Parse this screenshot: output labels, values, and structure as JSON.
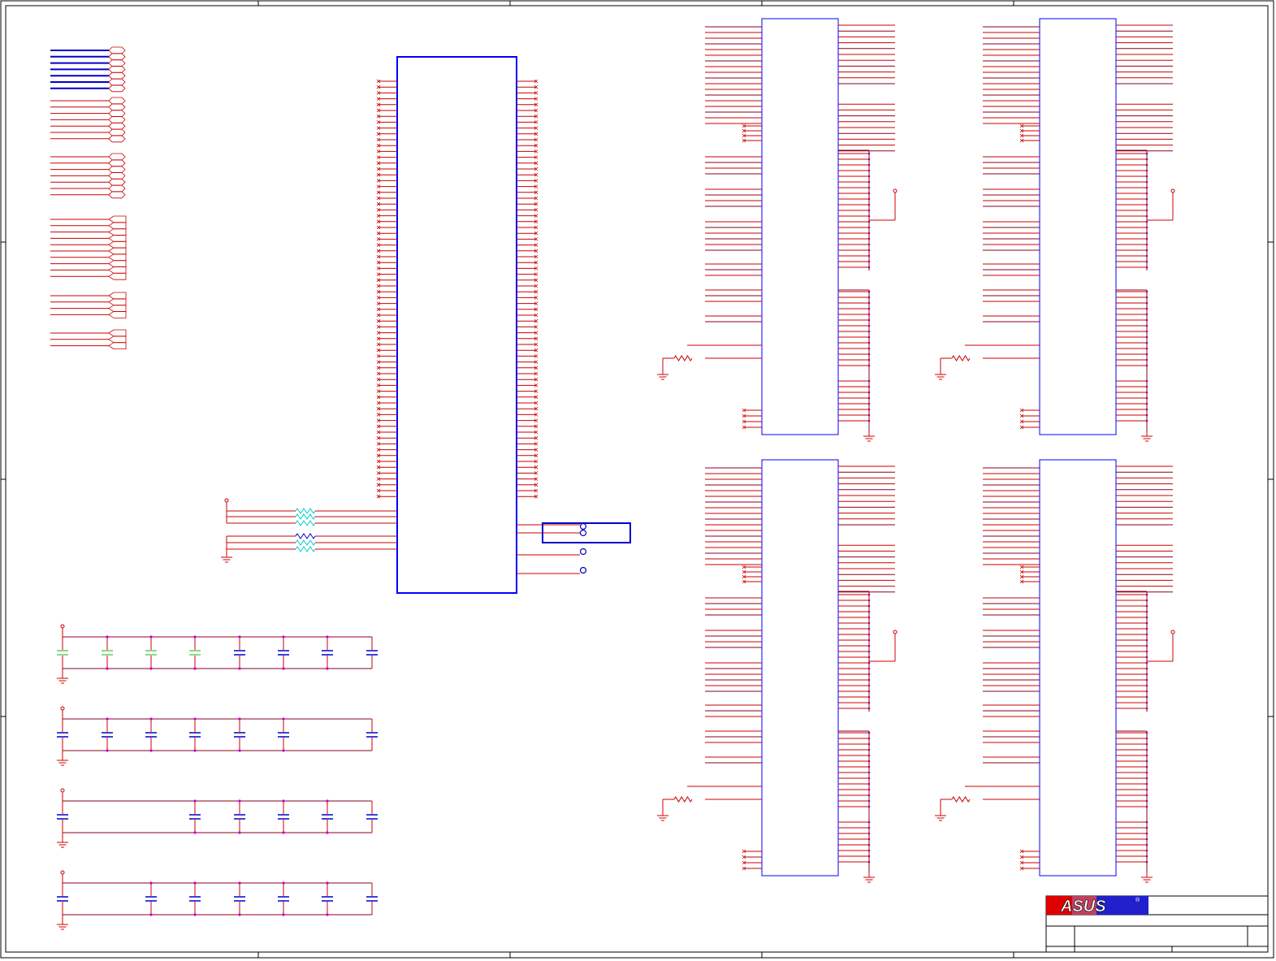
{
  "title_block": {
    "logo_text": "ASUS",
    "registered_mark": "®"
  },
  "colors": {
    "frame": "#000000",
    "wire": "#cc0000",
    "bus": "#0000cc",
    "component_box": "#0000cc",
    "ic_outline": "#0000ff",
    "junction": "#cc00cc",
    "resistor_highlight": "#00cccc",
    "capacitor_highlight": "#66cc66",
    "signal_dark": "#880022",
    "logo_red": "#e00000",
    "logo_blue": "#2020cc"
  },
  "schematic": {
    "hier_port_groups": [
      7,
      7,
      7,
      10,
      4,
      3
    ],
    "main_ic": {
      "left_pins": 72,
      "right_pins": 72
    },
    "memory_chips": 4,
    "decoupling_rows": [
      [
        true,
        true,
        true,
        true,
        true,
        true,
        true,
        true
      ],
      [
        true,
        true,
        true,
        true,
        true,
        true,
        false,
        true
      ],
      [
        true,
        false,
        false,
        true,
        true,
        true,
        true,
        true
      ],
      [
        true,
        false,
        true,
        true,
        true,
        true,
        true,
        true
      ]
    ],
    "test_points": 4
  }
}
